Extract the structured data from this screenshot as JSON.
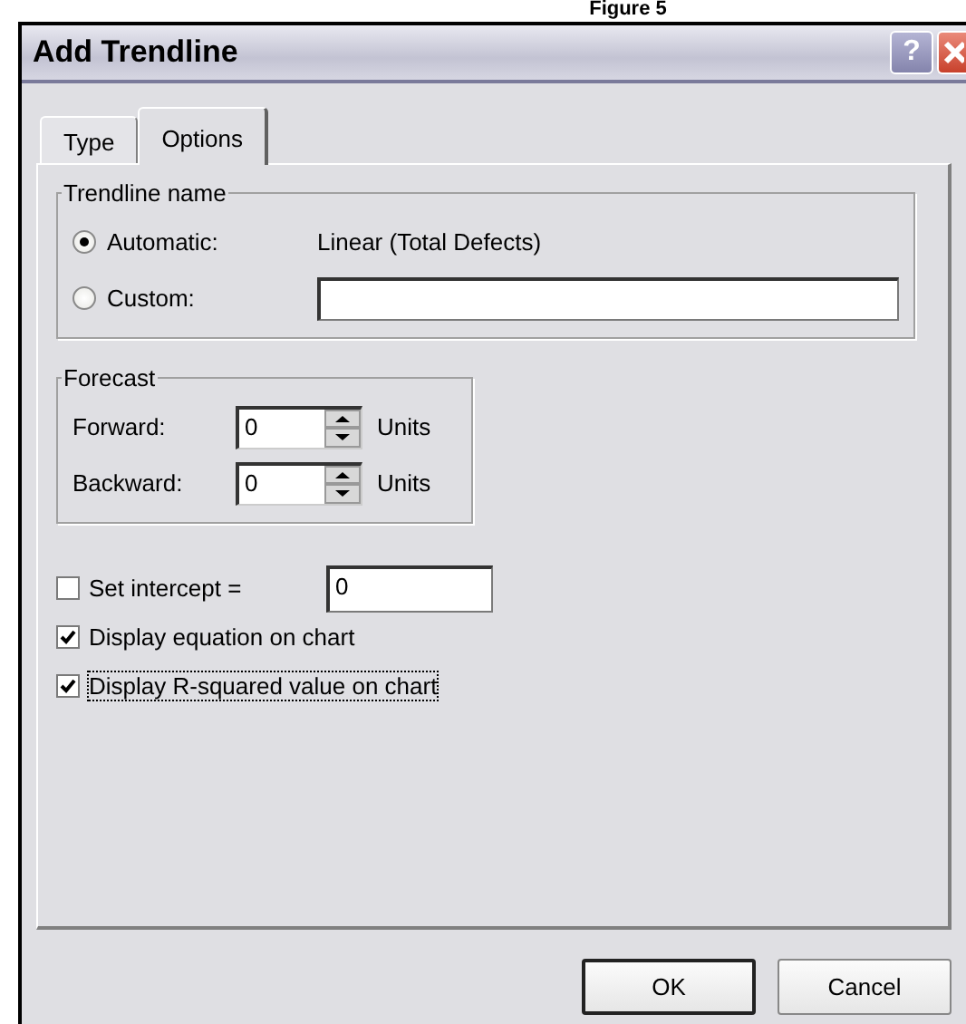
{
  "caption": "Figure 5",
  "window": {
    "title": "Add Trendline",
    "buttons": [
      {
        "kind": "help",
        "label": "?"
      },
      {
        "kind": "close"
      }
    ]
  },
  "tabs": [
    {
      "label": "Type",
      "selected": false
    },
    {
      "label": "Options",
      "selected": true
    }
  ],
  "trendline_name": {
    "title": "Trendline name",
    "options": [
      {
        "kind": "automatic",
        "label": "Automatic:",
        "selected": true,
        "value": "Linear (Total Defects)"
      },
      {
        "kind": "custom",
        "label": "Custom:",
        "selected": false
      }
    ]
  },
  "forecast": {
    "title": "Forecast",
    "rows": [
      {
        "label": "Forward:",
        "value": "0",
        "unit": "Units"
      },
      {
        "label": "Backward:",
        "value": "0",
        "unit": "Units"
      }
    ]
  },
  "options": [
    {
      "kind": "intercept",
      "label": "Set intercept =",
      "checked": false,
      "value": "0"
    },
    {
      "kind": "plain",
      "label": "Display equation on chart",
      "checked": true,
      "focused": false
    },
    {
      "kind": "plain",
      "label": "Display R-squared value on chart",
      "checked": true,
      "focused": true
    }
  ],
  "buttons": [
    {
      "label": "OK",
      "default": true
    },
    {
      "label": "Cancel",
      "default": false
    }
  ]
}
